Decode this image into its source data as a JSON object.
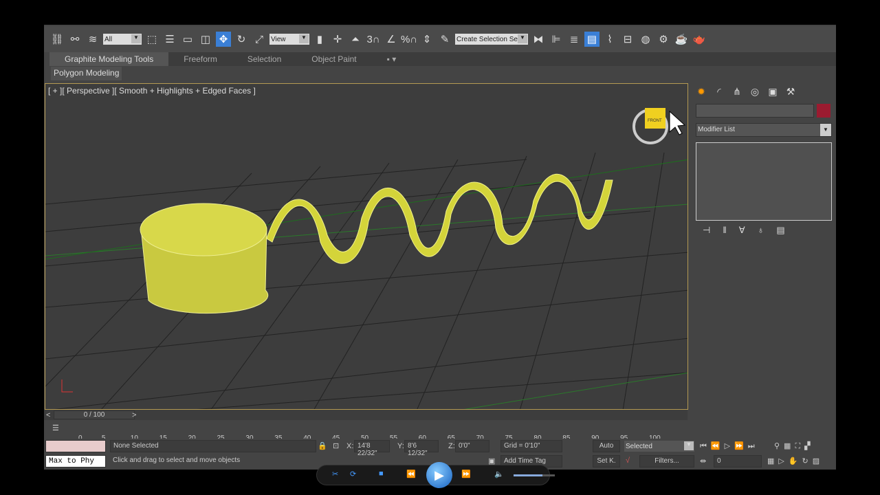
{
  "toolbar": {
    "filter_select": "All",
    "coord_select": "View",
    "snap_labels": [
      "3",
      "%"
    ],
    "named_selection": "Create Selection Se"
  },
  "ribbon": {
    "tabs": [
      "Graphite Modeling Tools",
      "Freeform",
      "Selection",
      "Object Paint"
    ],
    "panel": "Polygon Modeling"
  },
  "viewport": {
    "label": "[ + ][ Perspective ][ Smooth + Highlights + Edged Faces ]",
    "viewcube_face": "FRONT"
  },
  "command_panel": {
    "modifier_list": "Modifier List",
    "object_color": "#9b1b30"
  },
  "timeline": {
    "frame": "0 / 100",
    "ticks": [
      "0",
      "5",
      "10",
      "15",
      "20",
      "25",
      "30",
      "35",
      "40",
      "45",
      "50",
      "55",
      "60",
      "65",
      "70",
      "75",
      "80",
      "85",
      "90",
      "95",
      "100"
    ]
  },
  "status": {
    "maxscript": "Max to Phy",
    "selection": "None Selected",
    "prompt": "Click and drag to select and move objects",
    "x": "14'8 22/32\"",
    "y": "8'6 12/32\"",
    "z": "0'0\"",
    "x_label": "X:",
    "y_label": "Y:",
    "z_label": "Z:",
    "grid": "Grid = 0'10\"",
    "add_time_tag": "Add Time Tag",
    "auto": "Auto",
    "set_key": "Set K.",
    "key_mode": "Selected",
    "filters": "Filters...",
    "current_frame": "0"
  },
  "player": {
    "volume": 0.7
  }
}
